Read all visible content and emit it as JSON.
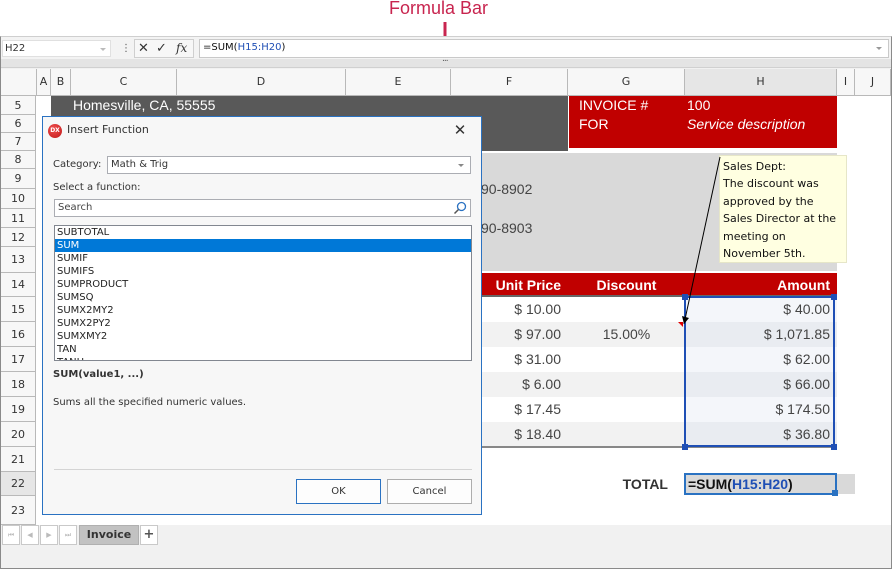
{
  "annotation": {
    "label": "Formula Bar",
    "color": "#c8254f"
  },
  "formula_bar": {
    "name_box": "H22",
    "more_glyph": "⋮",
    "cancel_glyph": "✕",
    "enter_glyph": "✓",
    "fx_glyph": "fx",
    "formula_prefix": "=SUM(",
    "formula_ref": "H15:H20",
    "formula_suffix": ")",
    "splitter_glyph": "..."
  },
  "columns": [
    "A",
    "B",
    "C",
    "D",
    "E",
    "F",
    "G",
    "H",
    "I",
    "J"
  ],
  "rows": [
    "5",
    "6",
    "7",
    "8",
    "9",
    "10",
    "11",
    "12",
    "13",
    "14",
    "15",
    "16",
    "17",
    "18",
    "19",
    "20",
    "21",
    "22",
    "23"
  ],
  "selected": {
    "column": "H",
    "row": "22"
  },
  "invoice": {
    "address": "Homesville, CA, 55555",
    "invoice_label": "INVOICE #",
    "invoice_number": "100",
    "for_label": "FOR",
    "for_value": "Service description",
    "phone_1": "90-8902",
    "phone_2": "90-8903",
    "table_headers": {
      "unit_price": "Unit Price",
      "discount": "Discount",
      "amount": "Amount"
    },
    "rows": [
      {
        "unit_price": "$ 10.00",
        "discount": "",
        "amount": "$ 40.00"
      },
      {
        "unit_price": "$ 97.00",
        "discount": "15.00%",
        "amount": "$ 1,071.85"
      },
      {
        "unit_price": "$ 31.00",
        "discount": "",
        "amount": "$ 62.00"
      },
      {
        "unit_price": "$ 6.00",
        "discount": "",
        "amount": "$ 66.00"
      },
      {
        "unit_price": "$ 17.45",
        "discount": "",
        "amount": "$ 174.50"
      },
      {
        "unit_price": "$ 18.40",
        "discount": "",
        "amount": "$ 36.80"
      }
    ],
    "total_label": "TOTAL",
    "total_formula_prefix": "=SUM(",
    "total_formula_ref": "H15:H20",
    "total_formula_suffix": ")"
  },
  "comment": {
    "lines": [
      "Sales Dept:",
      "The discount was",
      "approved by the",
      "Sales Director at the",
      "meeting on",
      "November 5th."
    ]
  },
  "dialog": {
    "icon_text": "DX",
    "title": "Insert Function",
    "close_glyph": "✕",
    "category_label": "Category:",
    "category_value": "Math & Trig",
    "select_label": "Select a function:",
    "search_placeholder": "Search",
    "functions": [
      "SUBTOTAL",
      "SUM",
      "SUMIF",
      "SUMIFS",
      "SUMPRODUCT",
      "SUMSQ",
      "SUMX2MY2",
      "SUMX2PY2",
      "SUMXMY2",
      "TAN",
      "TANH"
    ],
    "selected_function": "SUM",
    "signature": "SUM(value1, ...)",
    "description": "Sums all the specified numeric values.",
    "ok_label": "OK",
    "cancel_label": "Cancel"
  },
  "sheet_tabs": {
    "nav": [
      "⏮",
      "◀",
      "▶",
      "⏭"
    ],
    "tabs": [
      "Invoice"
    ],
    "add_glyph": "+"
  },
  "colors": {
    "header_red": "#c00000",
    "dark_gray": "#595959",
    "light_gray": "#d9d9d9",
    "selection_blue": "#1f4fb5",
    "dialog_border": "#2a72c2",
    "list_selection": "#0078d7",
    "comment_bg": "#ffffe1"
  }
}
